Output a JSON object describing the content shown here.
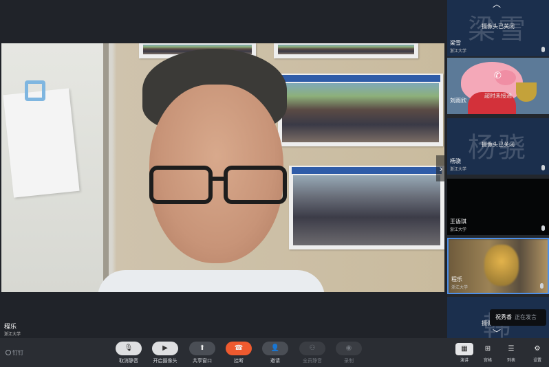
{
  "main": {
    "name": "程乐",
    "org": "浙江大学"
  },
  "participants": [
    {
      "bigname": "梁雪",
      "status": "摄像头已关闭",
      "name": "梁雪",
      "org": "浙江大学"
    },
    {
      "bigname": "",
      "status": "超时未接通",
      "name": "刘雨欣",
      "org": ""
    },
    {
      "bigname": "杨骁",
      "status": "摄像头已关闭",
      "name": "杨骁",
      "org": "浙江大学"
    },
    {
      "bigname": "",
      "status": "",
      "name": "王语琪",
      "org": "浙江大学"
    },
    {
      "bigname": "",
      "status": "",
      "name": "程乐",
      "org": "浙江大学"
    },
    {
      "bigname": "韩",
      "status": "摄像头已关闭",
      "name": "",
      "org": ""
    }
  ],
  "speaking": {
    "who": "祝秀香",
    "action": "正在发言"
  },
  "toolbar": {
    "pin": "钉钉",
    "buttons": [
      {
        "label": "取消静音"
      },
      {
        "label": "开启摄像头"
      },
      {
        "label": "共享窗口"
      },
      {
        "label": "挂断"
      },
      {
        "label": "邀请"
      },
      {
        "label": "全员静音"
      },
      {
        "label": "录制"
      }
    ],
    "views": [
      {
        "label": "演讲"
      },
      {
        "label": "宫格"
      },
      {
        "label": "列表"
      }
    ],
    "settings": "设置"
  },
  "colors": {
    "hangup": "#ee5a2f",
    "tile_bg": "#1b2f4d",
    "selected_border": "#4d8fe8"
  }
}
